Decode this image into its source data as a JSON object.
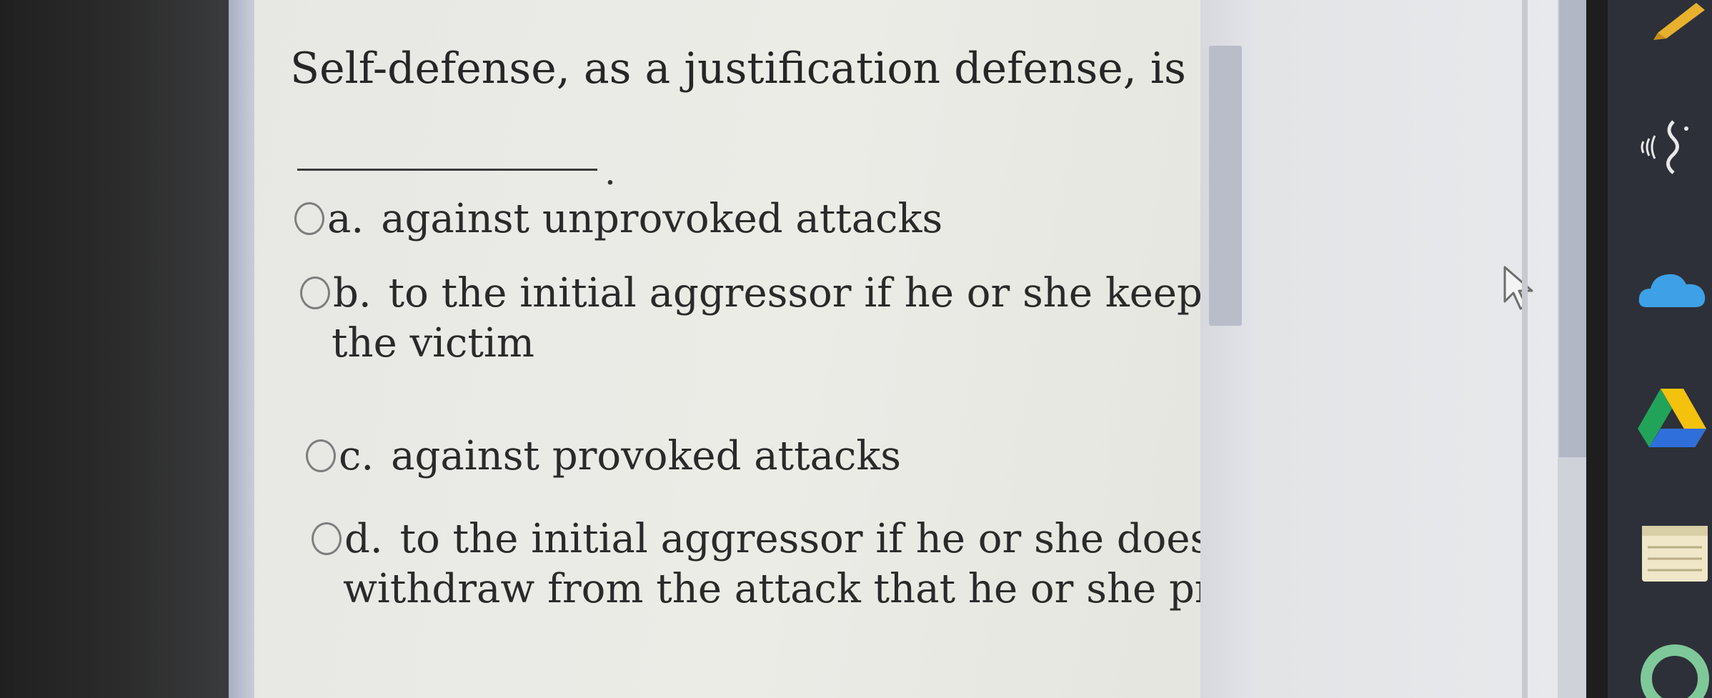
{
  "quiz": {
    "question": "Self-defense, as a justification defense, is only available",
    "blank_end": ".",
    "options": [
      {
        "letter": "a.",
        "line1": "against unprovoked attacks",
        "line2": ""
      },
      {
        "letter": "b.",
        "line1": "to the initial aggressor if he or she keeps attacking",
        "line2": "the victim"
      },
      {
        "letter": "c.",
        "line1": "against provoked attacks",
        "line2": ""
      },
      {
        "letter": "d.",
        "line1": "to the initial aggressor if he or she does not",
        "line2": "withdraw from the attack that he or she provoked"
      }
    ]
  },
  "icons": {
    "cursor": "mouse-pointer-icon",
    "taskbar": [
      "pencil-icon",
      "wifi-signal-icon",
      "onedrive-cloud-icon",
      "google-drive-icon",
      "notes-icon",
      "app-ring-icon"
    ]
  },
  "colors": {
    "onedrive": "#3ea0e6",
    "drive_green": "#22a35a",
    "drive_yellow": "#f4c20d",
    "drive_blue": "#2f6fdb",
    "pencil": "#e7b12e"
  }
}
